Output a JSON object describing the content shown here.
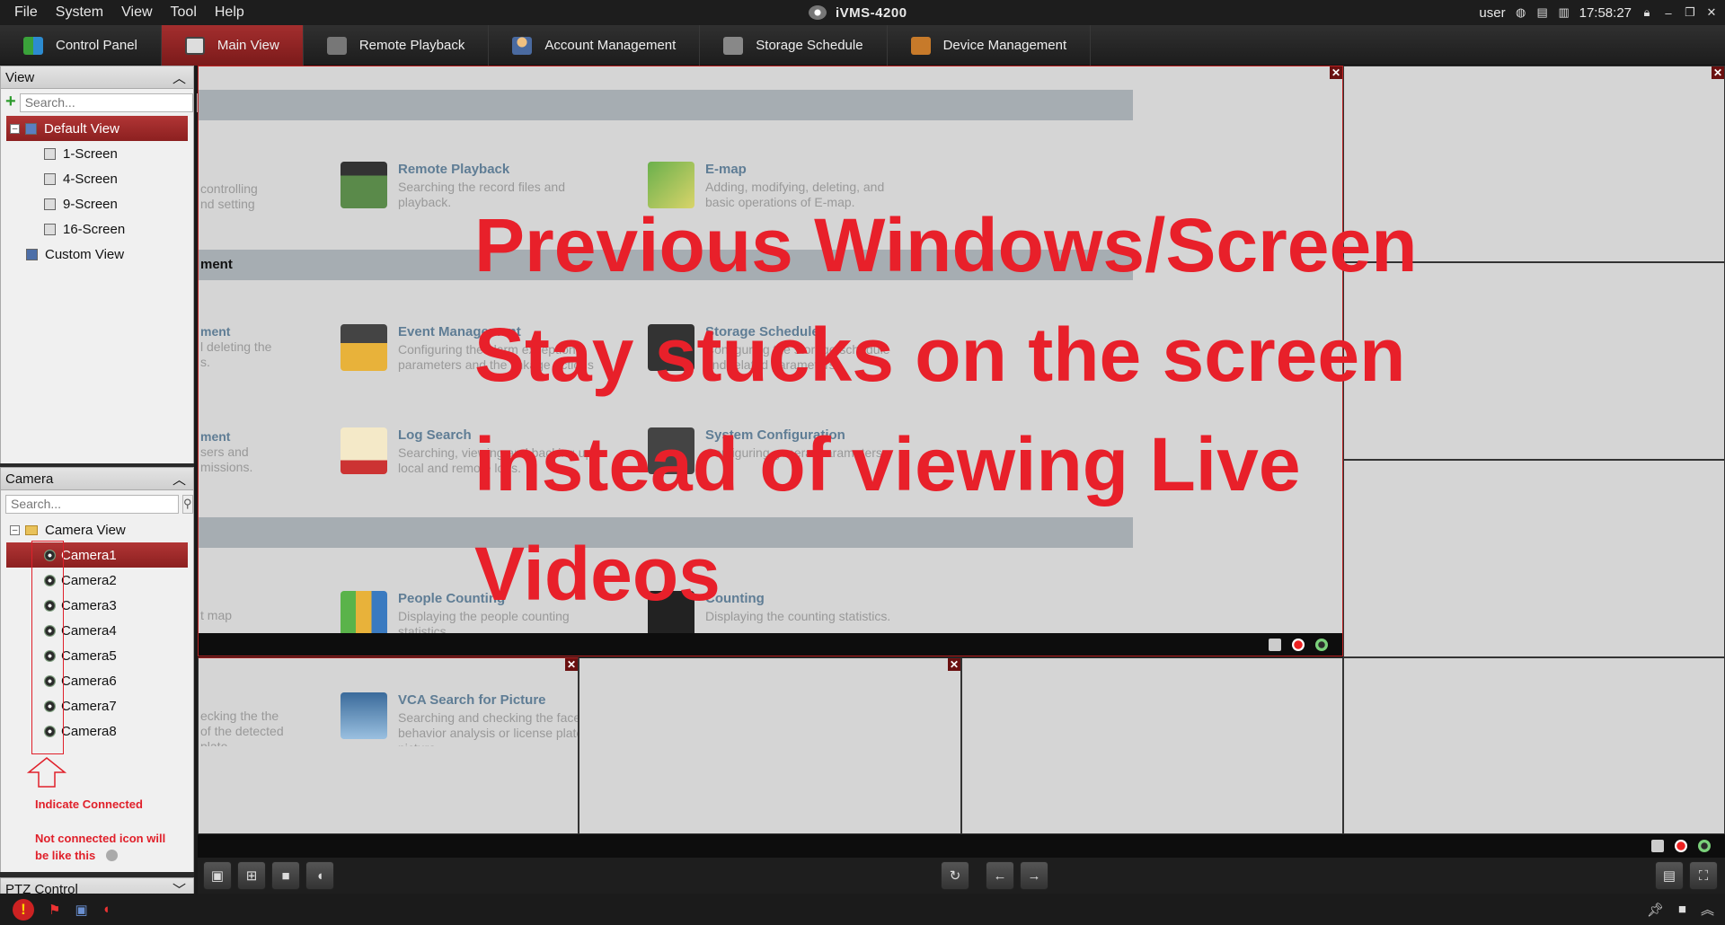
{
  "menubar": {
    "items": [
      "File",
      "System",
      "View",
      "Tool",
      "Help"
    ],
    "app_title": "iVMS-4200",
    "user": "user",
    "time": "17:58:27"
  },
  "tabs": [
    {
      "label": "Control Panel"
    },
    {
      "label": "Main View"
    },
    {
      "label": "Remote Playback"
    },
    {
      "label": "Account Management"
    },
    {
      "label": "Storage Schedule"
    },
    {
      "label": "Device Management"
    }
  ],
  "view_panel": {
    "title": "View",
    "search_placeholder": "Search...",
    "items": [
      "Default View",
      "1-Screen",
      "4-Screen",
      "9-Screen",
      "16-Screen",
      "Custom View"
    ]
  },
  "camera_panel": {
    "title": "Camera",
    "search_placeholder": "Search...",
    "root": "Camera View",
    "cameras": [
      "Camera1",
      "Camera2",
      "Camera3",
      "Camera4",
      "Camera5",
      "Camera6",
      "Camera7",
      "Camera8"
    ]
  },
  "annotations": {
    "connected": "Indicate Connected",
    "not_connected_1": "Not connected icon will",
    "not_connected_2": "be like this"
  },
  "ptz": {
    "title": "PTZ Control"
  },
  "control_panel_bg": {
    "section2": "ment",
    "frag1a": "controlling",
    "frag1b": "nd setting",
    "frag2a": "ment",
    "frag2b": "l deleting the",
    "frag2c": "s.",
    "frag3a": "ment",
    "frag3b": "sers and",
    "frag3c": "missions.",
    "frag4": "t map",
    "frag5a": "ecking the the",
    "frag5b": "of the detected",
    "frag5c": "plate",
    "items": [
      {
        "title": "Remote Playback",
        "desc": "Searching the record files and playback."
      },
      {
        "title": "E-map",
        "desc": "Adding, modifying, deleting, and basic operations of E-map."
      },
      {
        "title": "Event Management",
        "desc": "Configuring the alarm exception parameters and the linkage actions for the devices."
      },
      {
        "title": "Storage Schedule",
        "desc": "Configuring the storage schedule and related parameters."
      },
      {
        "title": "Log Search",
        "desc": "Searching, viewing and backing up local and remote logs."
      },
      {
        "title": "System Configuration",
        "desc": "Configuring general parameters."
      },
      {
        "title": "People Counting",
        "desc": "Displaying the people counting statistics."
      },
      {
        "title": "Counting",
        "desc": "Displaying the counting statistics."
      },
      {
        "title": "VCA Search for Picture",
        "desc": "Searching and checking the face, behavior analysis or license plate picture."
      }
    ]
  },
  "overlay_text": [
    "Previous Windows/Screen",
    "Stay stucks on the screen",
    "instead of viewing Live",
    "Videos"
  ],
  "colors": {
    "accent": "#a32e2e",
    "overlay": "#e8202a",
    "link_title": "#5f7d95"
  }
}
